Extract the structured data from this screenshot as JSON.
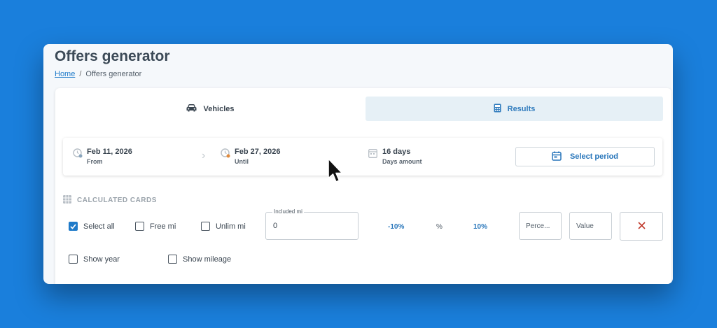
{
  "page": {
    "title": "Offers generator",
    "breadcrumb": {
      "home": "Home",
      "separator": "/",
      "current": "Offers generator"
    }
  },
  "tabs": [
    {
      "label": "Vehicles",
      "icon": "car-icon",
      "active": true
    },
    {
      "label": "Results",
      "icon": "calculator-icon",
      "active": false
    }
  ],
  "period": {
    "from": {
      "value": "Feb 11, 2026",
      "label": "From",
      "icon": "calendar-clock-icon"
    },
    "until": {
      "value": "Feb 27, 2026",
      "label": "Until",
      "icon": "calendar-clock-icon"
    },
    "days": {
      "value": "16 days",
      "label": "Days amount",
      "icon": "calendar-icon"
    },
    "select_label": "Select period"
  },
  "calculated": {
    "title": "CALCULATED CARDS",
    "checkboxes": [
      {
        "label": "Select all",
        "checked": true
      },
      {
        "label": "Free mi",
        "checked": false
      },
      {
        "label": "Unlim mi",
        "checked": false
      },
      {
        "label": "Show year",
        "checked": false
      },
      {
        "label": "Show mileage",
        "checked": false
      }
    ],
    "included_mi": {
      "label": "Included mi",
      "value": "0"
    },
    "minus_pct": "-10%",
    "pct_symbol": "%",
    "plus_pct": "10%",
    "percent_placeholder": "Perce...",
    "value_placeholder": "Value"
  },
  "colors": {
    "accent": "#1e7ac9",
    "background": "#1a7fdc",
    "danger": "#c0392b"
  }
}
